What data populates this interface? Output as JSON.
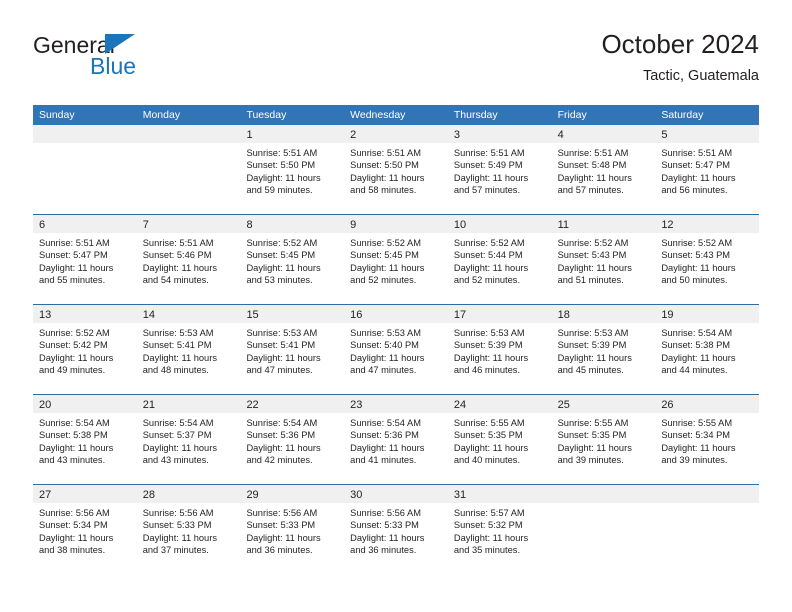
{
  "brand": {
    "name_top": "General",
    "name_bottom": "Blue",
    "accent_color": "#1b75bb"
  },
  "header": {
    "title": "October 2024",
    "subtitle": "Tactic, Guatemala"
  },
  "calendar": {
    "header_bg": "#3275b6",
    "row_divider_color": "#2e6da4",
    "day_band_bg": "#f0f0f0",
    "weekdays": [
      "Sunday",
      "Monday",
      "Tuesday",
      "Wednesday",
      "Thursday",
      "Friday",
      "Saturday"
    ],
    "weeks": [
      [
        {
          "day": "",
          "sunrise": "",
          "sunset": "",
          "daylight_1": "",
          "daylight_2": "",
          "empty": true
        },
        {
          "day": "",
          "sunrise": "",
          "sunset": "",
          "daylight_1": "",
          "daylight_2": "",
          "empty": true
        },
        {
          "day": "1",
          "sunrise": "Sunrise: 5:51 AM",
          "sunset": "Sunset: 5:50 PM",
          "daylight_1": "Daylight: 11 hours",
          "daylight_2": "and 59 minutes.",
          "empty": false
        },
        {
          "day": "2",
          "sunrise": "Sunrise: 5:51 AM",
          "sunset": "Sunset: 5:50 PM",
          "daylight_1": "Daylight: 11 hours",
          "daylight_2": "and 58 minutes.",
          "empty": false
        },
        {
          "day": "3",
          "sunrise": "Sunrise: 5:51 AM",
          "sunset": "Sunset: 5:49 PM",
          "daylight_1": "Daylight: 11 hours",
          "daylight_2": "and 57 minutes.",
          "empty": false
        },
        {
          "day": "4",
          "sunrise": "Sunrise: 5:51 AM",
          "sunset": "Sunset: 5:48 PM",
          "daylight_1": "Daylight: 11 hours",
          "daylight_2": "and 57 minutes.",
          "empty": false
        },
        {
          "day": "5",
          "sunrise": "Sunrise: 5:51 AM",
          "sunset": "Sunset: 5:47 PM",
          "daylight_1": "Daylight: 11 hours",
          "daylight_2": "and 56 minutes.",
          "empty": false
        }
      ],
      [
        {
          "day": "6",
          "sunrise": "Sunrise: 5:51 AM",
          "sunset": "Sunset: 5:47 PM",
          "daylight_1": "Daylight: 11 hours",
          "daylight_2": "and 55 minutes.",
          "empty": false
        },
        {
          "day": "7",
          "sunrise": "Sunrise: 5:51 AM",
          "sunset": "Sunset: 5:46 PM",
          "daylight_1": "Daylight: 11 hours",
          "daylight_2": "and 54 minutes.",
          "empty": false
        },
        {
          "day": "8",
          "sunrise": "Sunrise: 5:52 AM",
          "sunset": "Sunset: 5:45 PM",
          "daylight_1": "Daylight: 11 hours",
          "daylight_2": "and 53 minutes.",
          "empty": false
        },
        {
          "day": "9",
          "sunrise": "Sunrise: 5:52 AM",
          "sunset": "Sunset: 5:45 PM",
          "daylight_1": "Daylight: 11 hours",
          "daylight_2": "and 52 minutes.",
          "empty": false
        },
        {
          "day": "10",
          "sunrise": "Sunrise: 5:52 AM",
          "sunset": "Sunset: 5:44 PM",
          "daylight_1": "Daylight: 11 hours",
          "daylight_2": "and 52 minutes.",
          "empty": false
        },
        {
          "day": "11",
          "sunrise": "Sunrise: 5:52 AM",
          "sunset": "Sunset: 5:43 PM",
          "daylight_1": "Daylight: 11 hours",
          "daylight_2": "and 51 minutes.",
          "empty": false
        },
        {
          "day": "12",
          "sunrise": "Sunrise: 5:52 AM",
          "sunset": "Sunset: 5:43 PM",
          "daylight_1": "Daylight: 11 hours",
          "daylight_2": "and 50 minutes.",
          "empty": false
        }
      ],
      [
        {
          "day": "13",
          "sunrise": "Sunrise: 5:52 AM",
          "sunset": "Sunset: 5:42 PM",
          "daylight_1": "Daylight: 11 hours",
          "daylight_2": "and 49 minutes.",
          "empty": false
        },
        {
          "day": "14",
          "sunrise": "Sunrise: 5:53 AM",
          "sunset": "Sunset: 5:41 PM",
          "daylight_1": "Daylight: 11 hours",
          "daylight_2": "and 48 minutes.",
          "empty": false
        },
        {
          "day": "15",
          "sunrise": "Sunrise: 5:53 AM",
          "sunset": "Sunset: 5:41 PM",
          "daylight_1": "Daylight: 11 hours",
          "daylight_2": "and 47 minutes.",
          "empty": false
        },
        {
          "day": "16",
          "sunrise": "Sunrise: 5:53 AM",
          "sunset": "Sunset: 5:40 PM",
          "daylight_1": "Daylight: 11 hours",
          "daylight_2": "and 47 minutes.",
          "empty": false
        },
        {
          "day": "17",
          "sunrise": "Sunrise: 5:53 AM",
          "sunset": "Sunset: 5:39 PM",
          "daylight_1": "Daylight: 11 hours",
          "daylight_2": "and 46 minutes.",
          "empty": false
        },
        {
          "day": "18",
          "sunrise": "Sunrise: 5:53 AM",
          "sunset": "Sunset: 5:39 PM",
          "daylight_1": "Daylight: 11 hours",
          "daylight_2": "and 45 minutes.",
          "empty": false
        },
        {
          "day": "19",
          "sunrise": "Sunrise: 5:54 AM",
          "sunset": "Sunset: 5:38 PM",
          "daylight_1": "Daylight: 11 hours",
          "daylight_2": "and 44 minutes.",
          "empty": false
        }
      ],
      [
        {
          "day": "20",
          "sunrise": "Sunrise: 5:54 AM",
          "sunset": "Sunset: 5:38 PM",
          "daylight_1": "Daylight: 11 hours",
          "daylight_2": "and 43 minutes.",
          "empty": false
        },
        {
          "day": "21",
          "sunrise": "Sunrise: 5:54 AM",
          "sunset": "Sunset: 5:37 PM",
          "daylight_1": "Daylight: 11 hours",
          "daylight_2": "and 43 minutes.",
          "empty": false
        },
        {
          "day": "22",
          "sunrise": "Sunrise: 5:54 AM",
          "sunset": "Sunset: 5:36 PM",
          "daylight_1": "Daylight: 11 hours",
          "daylight_2": "and 42 minutes.",
          "empty": false
        },
        {
          "day": "23",
          "sunrise": "Sunrise: 5:54 AM",
          "sunset": "Sunset: 5:36 PM",
          "daylight_1": "Daylight: 11 hours",
          "daylight_2": "and 41 minutes.",
          "empty": false
        },
        {
          "day": "24",
          "sunrise": "Sunrise: 5:55 AM",
          "sunset": "Sunset: 5:35 PM",
          "daylight_1": "Daylight: 11 hours",
          "daylight_2": "and 40 minutes.",
          "empty": false
        },
        {
          "day": "25",
          "sunrise": "Sunrise: 5:55 AM",
          "sunset": "Sunset: 5:35 PM",
          "daylight_1": "Daylight: 11 hours",
          "daylight_2": "and 39 minutes.",
          "empty": false
        },
        {
          "day": "26",
          "sunrise": "Sunrise: 5:55 AM",
          "sunset": "Sunset: 5:34 PM",
          "daylight_1": "Daylight: 11 hours",
          "daylight_2": "and 39 minutes.",
          "empty": false
        }
      ],
      [
        {
          "day": "27",
          "sunrise": "Sunrise: 5:56 AM",
          "sunset": "Sunset: 5:34 PM",
          "daylight_1": "Daylight: 11 hours",
          "daylight_2": "and 38 minutes.",
          "empty": false
        },
        {
          "day": "28",
          "sunrise": "Sunrise: 5:56 AM",
          "sunset": "Sunset: 5:33 PM",
          "daylight_1": "Daylight: 11 hours",
          "daylight_2": "and 37 minutes.",
          "empty": false
        },
        {
          "day": "29",
          "sunrise": "Sunrise: 5:56 AM",
          "sunset": "Sunset: 5:33 PM",
          "daylight_1": "Daylight: 11 hours",
          "daylight_2": "and 36 minutes.",
          "empty": false
        },
        {
          "day": "30",
          "sunrise": "Sunrise: 5:56 AM",
          "sunset": "Sunset: 5:33 PM",
          "daylight_1": "Daylight: 11 hours",
          "daylight_2": "and 36 minutes.",
          "empty": false
        },
        {
          "day": "31",
          "sunrise": "Sunrise: 5:57 AM",
          "sunset": "Sunset: 5:32 PM",
          "daylight_1": "Daylight: 11 hours",
          "daylight_2": "and 35 minutes.",
          "empty": false
        },
        {
          "day": "",
          "sunrise": "",
          "sunset": "",
          "daylight_1": "",
          "daylight_2": "",
          "empty": true
        },
        {
          "day": "",
          "sunrise": "",
          "sunset": "",
          "daylight_1": "",
          "daylight_2": "",
          "empty": true
        }
      ]
    ]
  }
}
